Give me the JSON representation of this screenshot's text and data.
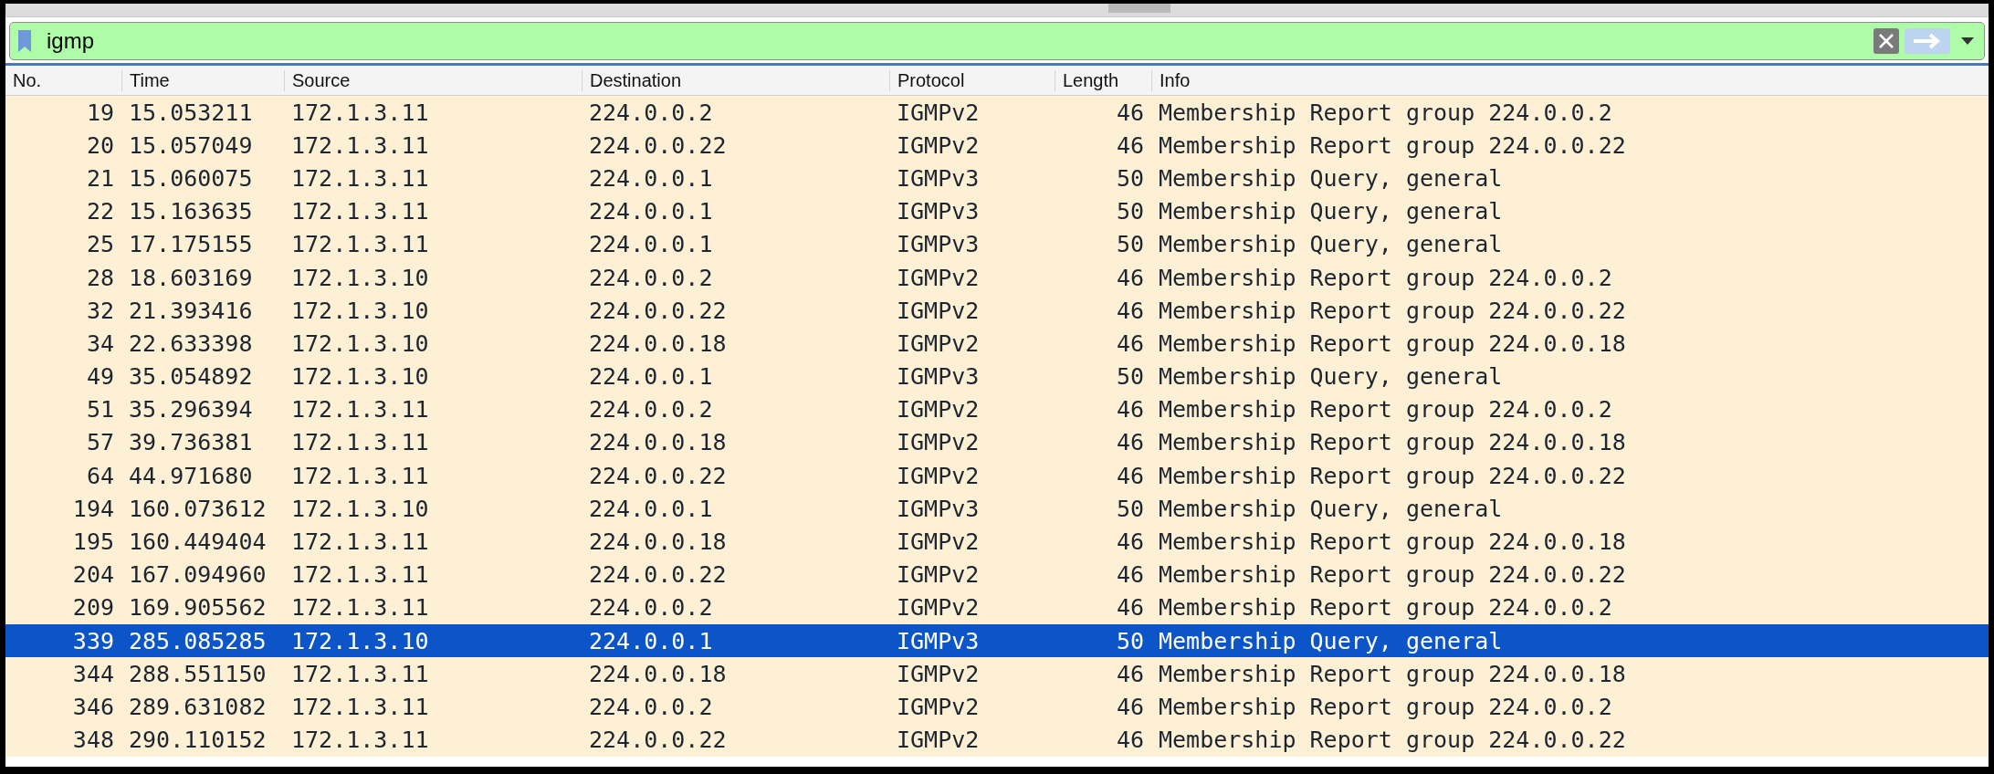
{
  "filter": {
    "value": "igmp"
  },
  "table": {
    "columns": [
      "No.",
      "Time",
      "Source",
      "Destination",
      "Protocol",
      "Length",
      "Info"
    ],
    "rows": [
      {
        "cells": [
          "19",
          "15.053211",
          "172.1.3.11",
          "224.0.0.2",
          "IGMPv2",
          "46",
          "Membership Report group 224.0.0.2"
        ],
        "selected": false
      },
      {
        "cells": [
          "20",
          "15.057049",
          "172.1.3.11",
          "224.0.0.22",
          "IGMPv2",
          "46",
          "Membership Report group 224.0.0.22"
        ],
        "selected": false
      },
      {
        "cells": [
          "21",
          "15.060075",
          "172.1.3.11",
          "224.0.0.1",
          "IGMPv3",
          "50",
          "Membership Query, general"
        ],
        "selected": false
      },
      {
        "cells": [
          "22",
          "15.163635",
          "172.1.3.11",
          "224.0.0.1",
          "IGMPv3",
          "50",
          "Membership Query, general"
        ],
        "selected": false
      },
      {
        "cells": [
          "25",
          "17.175155",
          "172.1.3.11",
          "224.0.0.1",
          "IGMPv3",
          "50",
          "Membership Query, general"
        ],
        "selected": false
      },
      {
        "cells": [
          "28",
          "18.603169",
          "172.1.3.10",
          "224.0.0.2",
          "IGMPv2",
          "46",
          "Membership Report group 224.0.0.2"
        ],
        "selected": false
      },
      {
        "cells": [
          "32",
          "21.393416",
          "172.1.3.10",
          "224.0.0.22",
          "IGMPv2",
          "46",
          "Membership Report group 224.0.0.22"
        ],
        "selected": false
      },
      {
        "cells": [
          "34",
          "22.633398",
          "172.1.3.10",
          "224.0.0.18",
          "IGMPv2",
          "46",
          "Membership Report group 224.0.0.18"
        ],
        "selected": false
      },
      {
        "cells": [
          "49",
          "35.054892",
          "172.1.3.10",
          "224.0.0.1",
          "IGMPv3",
          "50",
          "Membership Query, general"
        ],
        "selected": false
      },
      {
        "cells": [
          "51",
          "35.296394",
          "172.1.3.11",
          "224.0.0.2",
          "IGMPv2",
          "46",
          "Membership Report group 224.0.0.2"
        ],
        "selected": false
      },
      {
        "cells": [
          "57",
          "39.736381",
          "172.1.3.11",
          "224.0.0.18",
          "IGMPv2",
          "46",
          "Membership Report group 224.0.0.18"
        ],
        "selected": false
      },
      {
        "cells": [
          "64",
          "44.971680",
          "172.1.3.11",
          "224.0.0.22",
          "IGMPv2",
          "46",
          "Membership Report group 224.0.0.22"
        ],
        "selected": false
      },
      {
        "cells": [
          "194",
          "160.073612",
          "172.1.3.10",
          "224.0.0.1",
          "IGMPv3",
          "50",
          "Membership Query, general"
        ],
        "selected": false
      },
      {
        "cells": [
          "195",
          "160.449404",
          "172.1.3.11",
          "224.0.0.18",
          "IGMPv2",
          "46",
          "Membership Report group 224.0.0.18"
        ],
        "selected": false
      },
      {
        "cells": [
          "204",
          "167.094960",
          "172.1.3.11",
          "224.0.0.22",
          "IGMPv2",
          "46",
          "Membership Report group 224.0.0.22"
        ],
        "selected": false
      },
      {
        "cells": [
          "209",
          "169.905562",
          "172.1.3.11",
          "224.0.0.2",
          "IGMPv2",
          "46",
          "Membership Report group 224.0.0.2"
        ],
        "selected": false
      },
      {
        "cells": [
          "339",
          "285.085285",
          "172.1.3.10",
          "224.0.0.1",
          "IGMPv3",
          "50",
          "Membership Query, general"
        ],
        "selected": true
      },
      {
        "cells": [
          "344",
          "288.551150",
          "172.1.3.11",
          "224.0.0.18",
          "IGMPv2",
          "46",
          "Membership Report group 224.0.0.18"
        ],
        "selected": false
      },
      {
        "cells": [
          "346",
          "289.631082",
          "172.1.3.11",
          "224.0.0.2",
          "IGMPv2",
          "46",
          "Membership Report group 224.0.0.2"
        ],
        "selected": false
      },
      {
        "cells": [
          "348",
          "290.110152",
          "172.1.3.11",
          "224.0.0.22",
          "IGMPv2",
          "46",
          "Membership Report group 224.0.0.22"
        ],
        "selected": false
      }
    ]
  }
}
